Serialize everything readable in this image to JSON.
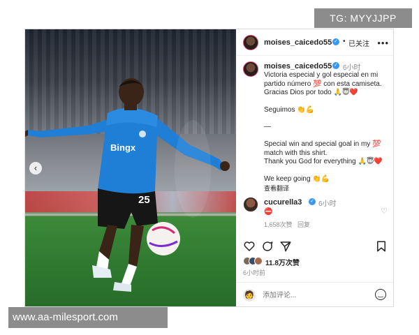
{
  "watermarks": {
    "top": "TG: MYYJJPP",
    "bottom": "www.aa-milesport.com"
  },
  "photo": {
    "jersey_sponsor": "Bingx",
    "shorts_number": "25",
    "carousel_prev_icon": "chevron-left-icon",
    "carousel_dots": 7,
    "carousel_active_index": 5
  },
  "header": {
    "username": "moises_caicedo55",
    "separator": "•",
    "follow_status": "已关注",
    "more_icon": "more-horizontal-icon"
  },
  "caption": {
    "username": "moises_caicedo55",
    "time": "6小时",
    "lines": [
      "Victoria especial y gol especial en mi partido número 💯 con esta camiseta.",
      "Gracias Dios por todo 🙏😇❤️",
      "",
      "Seguimos 👏💪",
      "",
      "—",
      "",
      "Special win and special goal in my 💯 match with this shirt.",
      "Thank you God for everything 🙏😇❤️",
      "",
      "We keep going 👏💪"
    ],
    "translate_label": "查看翻译"
  },
  "comment": {
    "username": "cucurella3",
    "time": "6小时",
    "text": "⛔",
    "likes": "1,658次赞",
    "reply_label": "回复"
  },
  "actions": {
    "like_icon": "heart-icon",
    "comment_icon": "comment-icon",
    "share_icon": "send-icon",
    "save_icon": "bookmark-icon",
    "likes_count": "11.8万次赞",
    "posted_time": "6小时前"
  },
  "comment_input": {
    "placeholder": "添加评论...",
    "emoji_icon": "smiley-icon"
  },
  "colors": {
    "verified": "#3897f0",
    "muted": "#8e8e8e",
    "text": "#262626",
    "jersey": "#1f7fd6"
  }
}
